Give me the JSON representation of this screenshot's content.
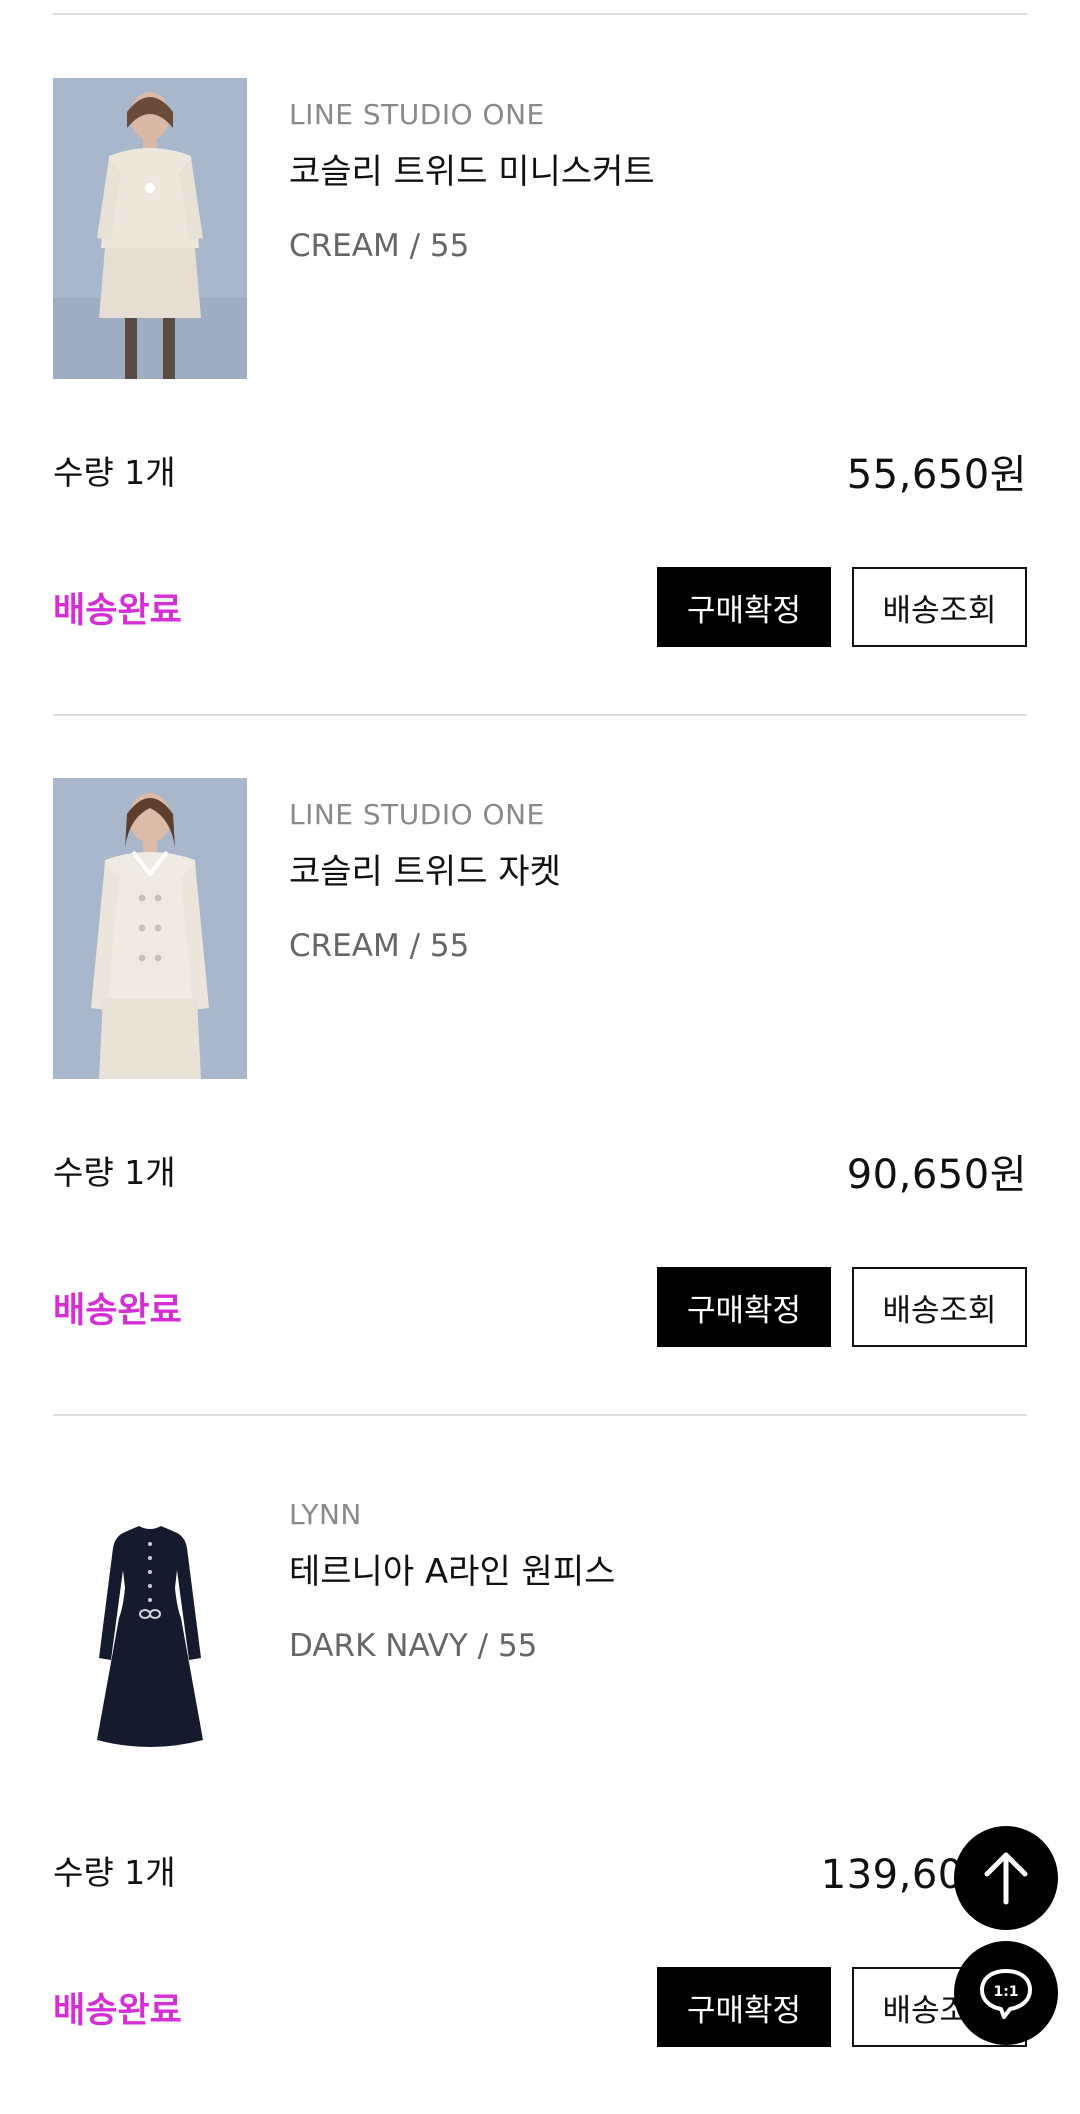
{
  "orders": [
    {
      "brand": "LINE STUDIO ONE",
      "name": "코슬리 트위드 미니스커트",
      "option": "CREAM / 55",
      "qty": "수량 1개",
      "price": "55,650원",
      "status": "배송완료",
      "confirm_label": "구매확정",
      "track_label": "배송조회",
      "image_icon": "model-photo-tweed-skirt-cream"
    },
    {
      "brand": "LINE STUDIO ONE",
      "name": "코슬리 트위드 자켓",
      "option": "CREAM / 55",
      "qty": "수량 1개",
      "price": "90,650원",
      "status": "배송완료",
      "confirm_label": "구매확정",
      "track_label": "배송조회",
      "image_icon": "model-photo-tweed-jacket-cream"
    },
    {
      "brand": "LYNN",
      "name": "테르니아 A라인 원피스",
      "option": "DARK NAVY / 55",
      "qty": "수량 1개",
      "price": "139,600원",
      "status": "배송완료",
      "confirm_label": "구매확정",
      "track_label": "배송조회",
      "image_icon": "product-photo-navy-dress"
    }
  ],
  "floating": {
    "scroll_top_icon": "arrow-up-icon",
    "chat_icon": "chat-bubble-icon",
    "chat_label": "1:1"
  },
  "colors": {
    "status": "#d62ed6",
    "primary_button": "#000000",
    "divider": "#dcdcdc"
  }
}
